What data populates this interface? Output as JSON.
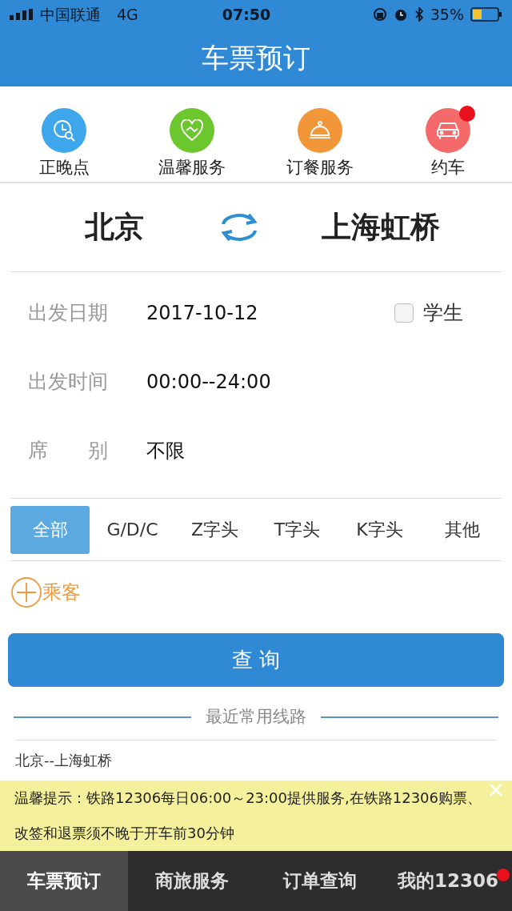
{
  "status_bar": {
    "carrier": "中国联通",
    "network": "4G",
    "time": "07:50",
    "battery": "35%"
  },
  "header": {
    "title": "车票预订"
  },
  "services": [
    {
      "label": "正晚点",
      "kind": "clock",
      "color": "#3ea6ea",
      "badge": false
    },
    {
      "label": "温馨服务",
      "kind": "heart",
      "color": "#6cc72e",
      "badge": false
    },
    {
      "label": "订餐服务",
      "kind": "meal",
      "color": "#f2963a",
      "badge": false
    },
    {
      "label": "约车",
      "kind": "car",
      "color": "#f46a6a",
      "badge": true
    }
  ],
  "route": {
    "from": "北京",
    "to": "上海虹桥"
  },
  "fields": [
    {
      "label": "出发日期",
      "value": "2017-10-12"
    },
    {
      "label": "出发时间",
      "value": "00:00--24:00"
    },
    {
      "label": "席　　别",
      "value": "不限"
    }
  ],
  "student": {
    "label": "学生",
    "checked": false
  },
  "train_types": [
    {
      "label": "全部",
      "selected": true
    },
    {
      "label": "G/D/C",
      "selected": false
    },
    {
      "label": "Z字头",
      "selected": false
    },
    {
      "label": "T字头",
      "selected": false
    },
    {
      "label": "K字头",
      "selected": false
    },
    {
      "label": "其他",
      "selected": false
    }
  ],
  "passenger": {
    "label": "乘客"
  },
  "query_button": "查 询",
  "recent": {
    "title": "最近常用线路",
    "routes": [
      "北京--上海虹桥"
    ]
  },
  "notice": "温馨提示：铁路12306每日06:00～23:00提供服务,在铁路12306购票、改签和退票须不晚于开车前30分钟",
  "tabs": [
    {
      "label": "车票预订",
      "selected": true,
      "badge": false
    },
    {
      "label": "商旅服务",
      "selected": false,
      "badge": false
    },
    {
      "label": "订单查询",
      "selected": false,
      "badge": false
    },
    {
      "label": "我的12306",
      "selected": false,
      "badge": true
    }
  ]
}
